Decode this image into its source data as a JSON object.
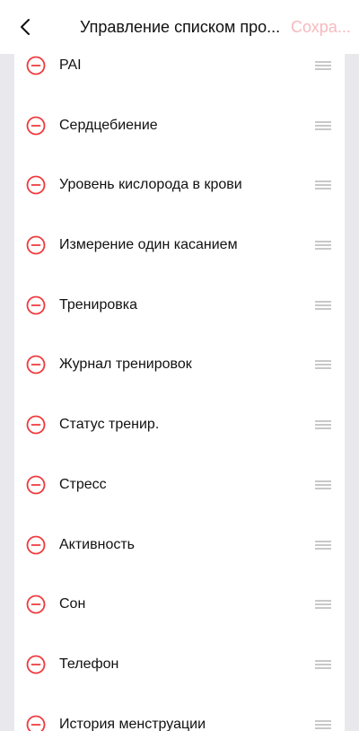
{
  "header": {
    "title": "Управление списком про...",
    "save_label": "Сохра...",
    "back_icon": "chevron-left-icon"
  },
  "colors": {
    "accent": "#f0393d",
    "save_disabled": "#f6b9bd",
    "background": "#e9e9ed",
    "card": "#ffffff",
    "handle": "#b5b5b5"
  },
  "list": {
    "items": [
      {
        "label": "PAI"
      },
      {
        "label": "Сердцебиение"
      },
      {
        "label": "Уровень кислорода в крови"
      },
      {
        "label": "Измерение один касанием"
      },
      {
        "label": "Тренировка"
      },
      {
        "label": "Журнал тренировок"
      },
      {
        "label": "Статус тренир."
      },
      {
        "label": "Стресс"
      },
      {
        "label": "Активность"
      },
      {
        "label": "Сон"
      },
      {
        "label": "Телефон"
      },
      {
        "label": "История менструации"
      }
    ]
  }
}
